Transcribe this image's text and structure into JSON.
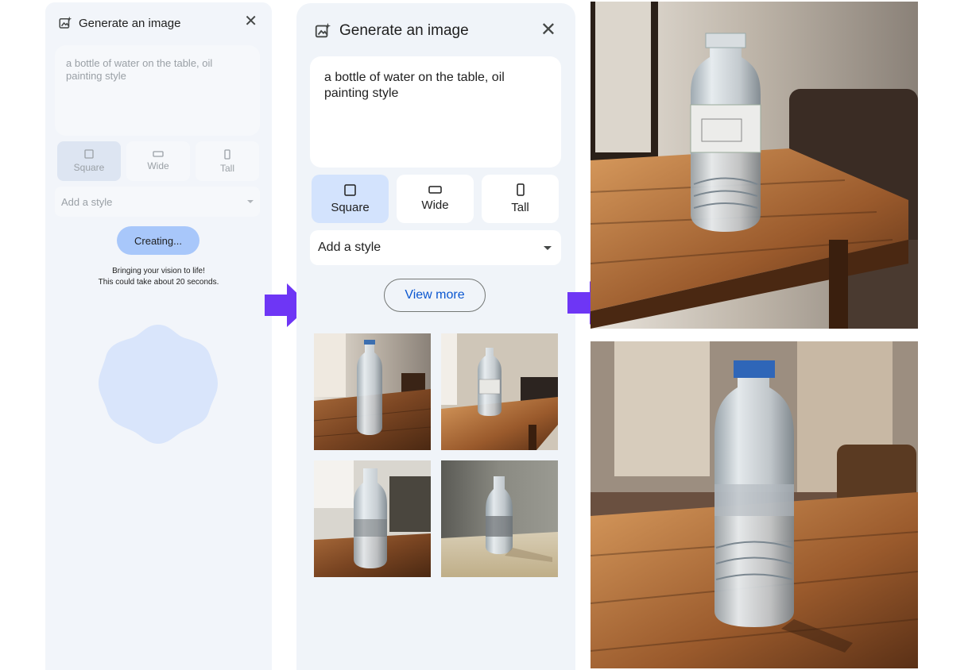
{
  "loading_panel": {
    "title": "Generate an image",
    "prompt": "a bottle of water on the table, oil painting style",
    "aspect_ratios": [
      {
        "label": "Square",
        "icon": "square-icon",
        "selected": true
      },
      {
        "label": "Wide",
        "icon": "wide-rect-icon",
        "selected": false
      },
      {
        "label": "Tall",
        "icon": "tall-rect-icon",
        "selected": false
      }
    ],
    "style_placeholder": "Add a style",
    "status_button": "Creating...",
    "message_line1": "Bringing your vision to life!",
    "message_line2": "This could take about 20 seconds."
  },
  "results_panel": {
    "title": "Generate an image",
    "prompt": "a bottle of water on the table, oil painting style",
    "aspect_ratios": [
      {
        "label": "Square",
        "icon": "square-icon",
        "selected": true
      },
      {
        "label": "Wide",
        "icon": "wide-rect-icon",
        "selected": false
      },
      {
        "label": "Tall",
        "icon": "tall-rect-icon",
        "selected": false
      }
    ],
    "style_placeholder": "Add a style",
    "view_more": "View more",
    "thumbnails": [
      "generated-image-1",
      "generated-image-2",
      "generated-image-3",
      "generated-image-4"
    ]
  },
  "colors": {
    "panel_bg": "#f0f4f9",
    "selected_chip": "#d3e3fd",
    "creating_button": "#a8c7fa",
    "link_blue": "#0b57d0",
    "arrow_purple": "#6e36f5",
    "loader_blob": "#d9e5fb"
  }
}
